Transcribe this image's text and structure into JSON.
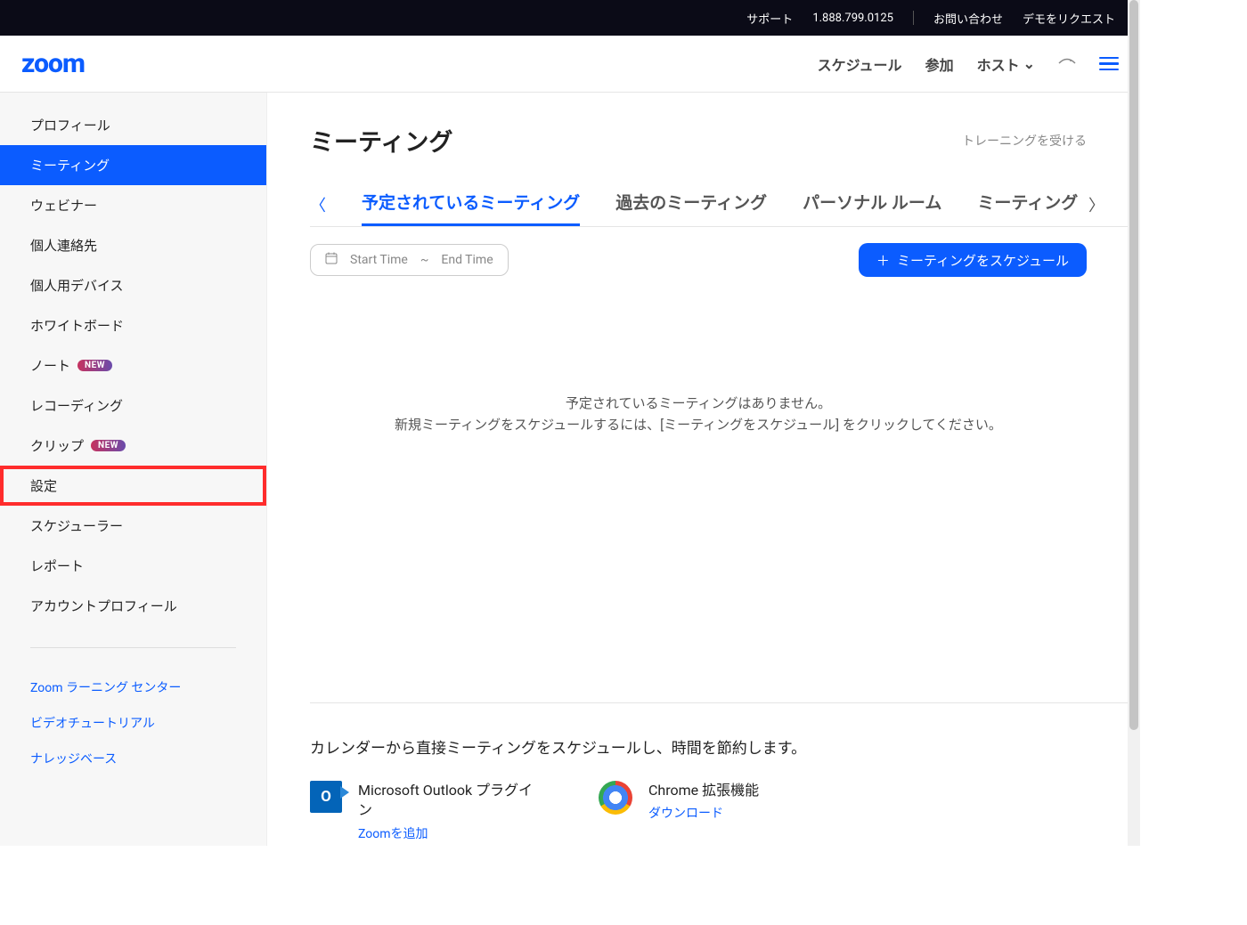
{
  "topbar": {
    "support": "サポート",
    "phone": "1.888.799.0125",
    "contact": "お問い合わせ",
    "request_demo": "デモをリクエスト"
  },
  "header": {
    "logo_text": "zoom",
    "nav_schedule": "スケジュール",
    "nav_join": "参加",
    "nav_host": "ホスト"
  },
  "sidebar": {
    "items": [
      {
        "label": "プロフィール",
        "active": false
      },
      {
        "label": "ミーティング",
        "active": true
      },
      {
        "label": "ウェビナー",
        "active": false
      },
      {
        "label": "個人連絡先",
        "active": false
      },
      {
        "label": "個人用デバイス",
        "active": false
      },
      {
        "label": "ホワイトボード",
        "active": false
      },
      {
        "label": "ノート",
        "active": false,
        "badge": "NEW"
      },
      {
        "label": "レコーディング",
        "active": false
      },
      {
        "label": "クリップ",
        "active": false,
        "badge": "NEW"
      },
      {
        "label": "設定",
        "active": false,
        "highlighted": true
      },
      {
        "label": "スケジューラー",
        "active": false
      },
      {
        "label": "レポート",
        "active": false
      },
      {
        "label": "アカウントプロフィール",
        "active": false
      }
    ],
    "links": [
      {
        "label": "Zoom ラーニング センター"
      },
      {
        "label": "ビデオチュートリアル"
      },
      {
        "label": "ナレッジベース"
      }
    ]
  },
  "main": {
    "title": "ミーティング",
    "training_link": "トレーニングを受ける",
    "tabs": [
      {
        "label": "予定されているミーティング",
        "active": true
      },
      {
        "label": "過去のミーティング"
      },
      {
        "label": "パーソナル ルーム"
      },
      {
        "label": "ミーティング"
      }
    ],
    "date_picker": {
      "start": "Start Time",
      "sep": "~",
      "end": "End Time"
    },
    "schedule_button": "ミーティングをスケジュール",
    "empty_line1": "予定されているミーティングはありません。",
    "empty_line2": "新規ミーティングをスケジュールするには、[ミーティングをスケジュール] をクリックしてください。",
    "integrations": {
      "heading": "カレンダーから直接ミーティングをスケジュールし、時間を節約します。",
      "outlook_title": "Microsoft Outlook プラグイン",
      "outlook_link": "Zoomを追加",
      "chrome_title": "Chrome 拡張機能",
      "chrome_link": "ダウンロード"
    }
  }
}
